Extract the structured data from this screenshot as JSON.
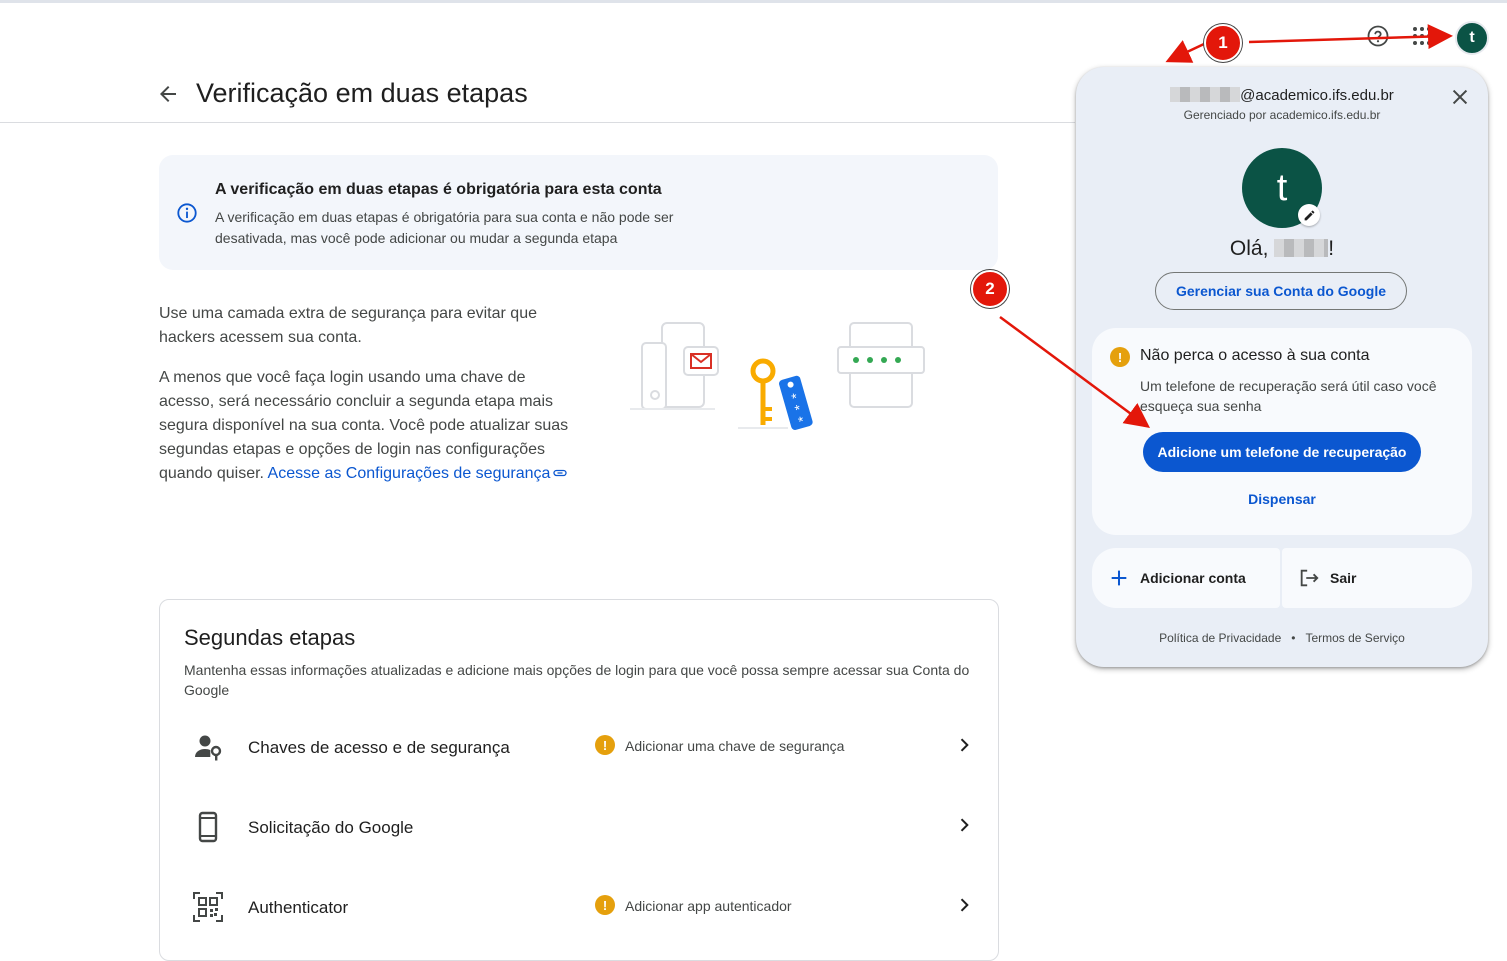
{
  "header": {
    "page_title": "Verificação em duas etapas"
  },
  "notice": {
    "title": "A verificação em duas etapas é obrigatória para esta conta",
    "body": "A verificação em duas etapas é obrigatória para sua conta e não pode ser desativada, mas você pode adicionar ou mudar a segunda etapa"
  },
  "intro": {
    "p1": "Use uma camada extra de segurança para evitar que hackers acessem sua conta.",
    "p2": "A menos que você faça login usando uma chave de acesso, será necessário concluir a segunda etapa mais segura disponível na sua conta. Você pode atualizar suas segundas etapas e opções de login nas configurações quando quiser.",
    "link": "Acesse as Configurações de segurança"
  },
  "second_steps": {
    "title": "Segundas etapas",
    "description": "Mantenha essas informações atualizadas e adicione mais opções de login para que você possa sempre acessar sua Conta do Google",
    "rows": [
      {
        "label": "Chaves de acesso e de segurança",
        "status": "Adicionar uma chave de segurança",
        "icon": "person-key-icon"
      },
      {
        "label": "Solicitação do Google",
        "status": "",
        "icon": "phone-icon"
      },
      {
        "label": "Authenticator",
        "status": "Adicionar app autenticador",
        "icon": "qr-code-icon"
      }
    ]
  },
  "account_popup": {
    "email_domain": "@academico.ifs.edu.br",
    "managed_by": "Gerenciado por academico.ifs.edu.br",
    "avatar_letter": "t",
    "hello_prefix": "Olá,",
    "hello_suffix": "!",
    "manage_button": "Gerenciar sua Conta do Google",
    "alert": {
      "title": "Não perca o acesso à sua conta",
      "body": "Um telefone de recuperação será útil caso você esqueça sua senha",
      "primary_button": "Adicione um telefone de recuperação",
      "dismiss": "Dispensar"
    },
    "add_account": "Adicionar conta",
    "sign_out": "Sair",
    "privacy": "Política de Privacidade",
    "separator": "•",
    "terms": "Termos de Serviço"
  },
  "top_bar": {
    "avatar_letter": "t"
  },
  "annotations": {
    "marker_1": "1",
    "marker_2": "2",
    "color": "#e3170a"
  },
  "colors": {
    "accent": "#0b57d0",
    "avatar": "#0b5345",
    "warning": "#e5a00d"
  }
}
